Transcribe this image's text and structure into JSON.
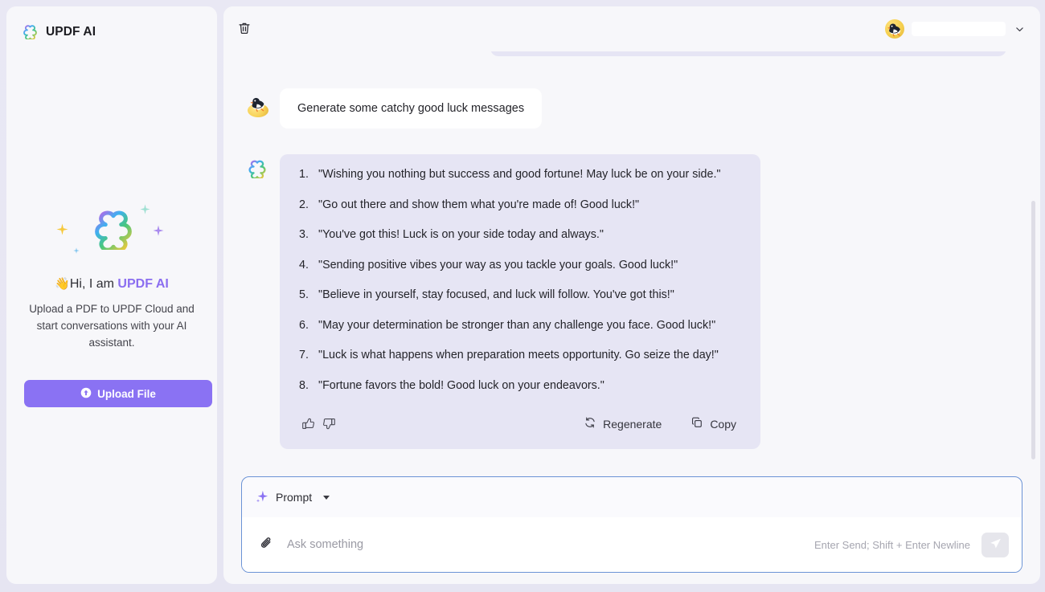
{
  "app": {
    "title": "UPDF AI",
    "logo_icon": "updf-clover-logo-icon"
  },
  "sidebar": {
    "brand_label": "UPDF AI",
    "hero": {
      "wave_emoji": "👋",
      "greeting_prefix": "Hi, I am ",
      "greeting_brand": "UPDF AI",
      "description": "Upload a PDF to UPDF Cloud and start conversations with your AI assistant.",
      "logo_icon": "updf-clover-logo-icon",
      "sparkle_icons": [
        "sparkle-yellow-icon",
        "sparkle-blue-small-icon",
        "sparkle-teal-icon",
        "sparkle-purple-icon"
      ]
    },
    "upload_button": {
      "label": "Upload File",
      "icon": "upload-circle-arrow-icon",
      "color": "#8a72f3"
    }
  },
  "topbar": {
    "delete_icon": "trash-icon",
    "user_name": "",
    "avatar_icon": "user-avatar-bird-icon",
    "dropdown_icon": "chevron-down-icon"
  },
  "chat": {
    "user_message": {
      "text": "Generate some catchy good luck messages",
      "avatar_icon": "user-avatar-bird-icon"
    },
    "ai_message": {
      "avatar_icon": "updf-clover-logo-icon",
      "items": [
        "\"Wishing you nothing but success and good fortune! May luck be on your side.\"",
        "\"Go out there and show them what you're made of! Good luck!\"",
        "\"You've got this! Luck is on your side today and always.\"",
        "\"Sending positive vibes your way as you tackle your goals. Good luck!\"",
        "\"Believe in yourself, stay focused, and luck will follow. You've got this!\"",
        "\"May your determination be stronger than any challenge you face. Good luck!\"",
        "\"Luck is what happens when preparation meets opportunity. Go seize the day!\"",
        "\"Fortune favors the bold! Good luck on your endeavors.\""
      ],
      "actions": {
        "like_icon": "thumbs-up-icon",
        "dislike_icon": "thumbs-down-icon",
        "regenerate_label": "Regenerate",
        "regenerate_icon": "refresh-icon",
        "copy_label": "Copy",
        "copy_icon": "copy-icon"
      }
    }
  },
  "composer": {
    "prompt_label": "Prompt",
    "prompt_icon": "sparkle-purple-icon",
    "dropdown_icon": "caret-down-icon",
    "attach_icon": "paperclip-icon",
    "input_value": "",
    "input_placeholder": "Ask something",
    "hint": "Enter Send; Shift + Enter Newline",
    "send_icon": "send-paper-plane-icon",
    "border_color": "#6b93d6"
  },
  "colors": {
    "page_bg": "#e7e6f3",
    "panel_bg": "#f7f7fa",
    "ai_bubble": "#e6e5f4",
    "accent_purple": "#8a72f3"
  }
}
